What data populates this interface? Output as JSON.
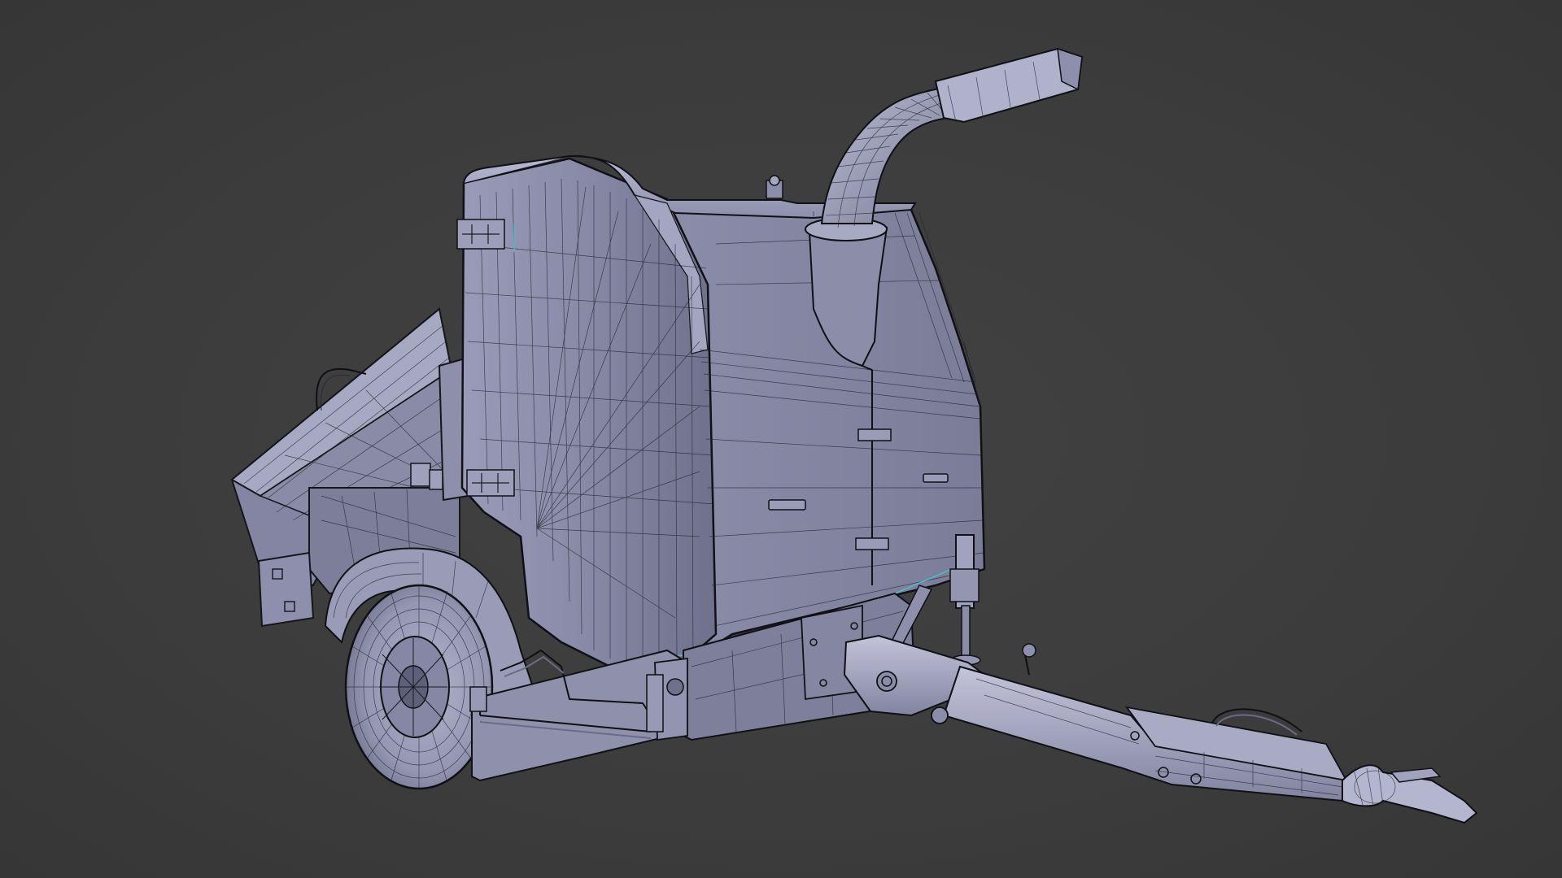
{
  "viewport": {
    "background_color": "#3d3d3d",
    "display_mode": "wireframe-on-shaded"
  },
  "model": {
    "object": "wood-chipper-trailer",
    "surface_color": "#8e8fab",
    "surface_light_color": "#b6b7cf",
    "surface_dark_color": "#6d6e88",
    "wire_color": "#1b1b24",
    "selection_edge_color": "#4fb9c4"
  }
}
